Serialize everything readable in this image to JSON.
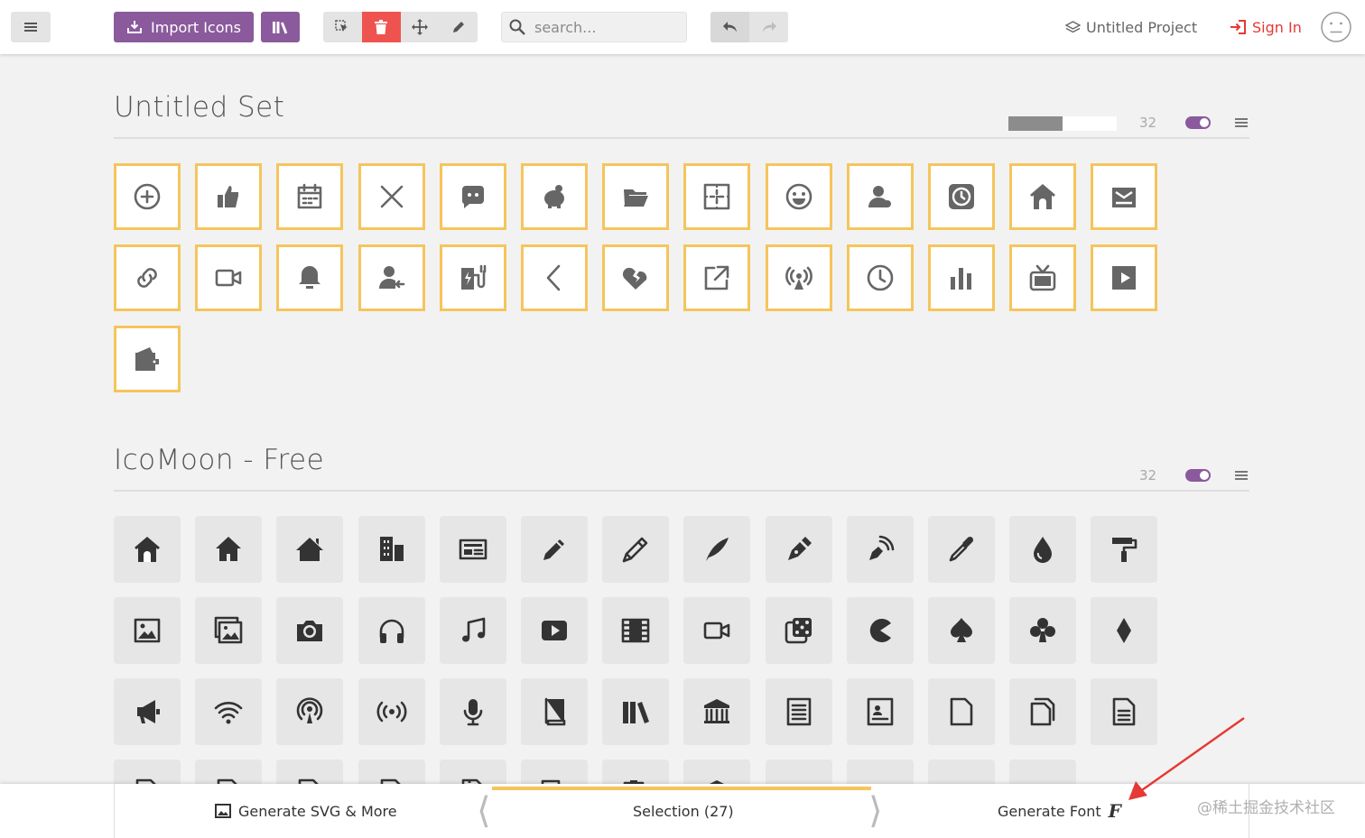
{
  "toolbar": {
    "import_label": "Import Icons",
    "search_placeholder": "search...",
    "project_name": "Untitled Project",
    "sign_in_label": "Sign In"
  },
  "sets": [
    {
      "title": "Untitled Set",
      "count": "32",
      "icons": [
        "plus-circle",
        "thumbs-up",
        "calendar",
        "close",
        "chat-bubble",
        "piggy-bank",
        "folder-open",
        "expand",
        "smile",
        "user",
        "clock-square",
        "home",
        "mail-open",
        "link",
        "video-camera",
        "bell",
        "user-arrow",
        "charging-station",
        "chevron-left",
        "heart-broken",
        "external-link",
        "broadcast",
        "clock",
        "bar-chart",
        "tv",
        "play-square",
        "wallet"
      ]
    },
    {
      "title": "IcoMoon - Free",
      "count": "32",
      "icons": [
        "home",
        "home2",
        "home3",
        "office",
        "newspaper",
        "pencil",
        "pencil2",
        "quill",
        "pen",
        "blog",
        "eyedropper",
        "droplet",
        "paint-format",
        "image",
        "images",
        "camera",
        "headphones",
        "music",
        "play",
        "film",
        "video-camera",
        "dice",
        "pacman",
        "spades",
        "clubs",
        "diamonds",
        "bullhorn",
        "connection",
        "podcast",
        "feed",
        "mic",
        "book",
        "books",
        "library",
        "file-text",
        "profile",
        "file-empty",
        "files-empty",
        "file-text2",
        "file-picture",
        "file-music",
        "file-play",
        "file-video",
        "file-zip",
        "copy",
        "paste",
        "stack",
        "folder",
        "folder-open",
        "folder-plus",
        "folder-minus"
      ]
    }
  ],
  "bottom": {
    "generate_svg_label": "Generate SVG & More",
    "selection_label": "Selection (27)",
    "generate_font_label": "Generate Font"
  },
  "watermark": "@稀土掘金技术社区",
  "colors": {
    "accent": "#8a5a9c",
    "danger": "#e53935",
    "selected_border": "#f5c55c",
    "annotation_arrow": "#e53935"
  }
}
